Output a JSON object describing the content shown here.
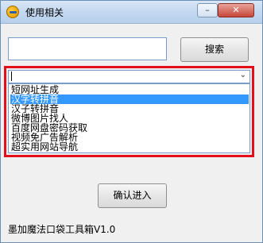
{
  "window": {
    "title": "使用相关",
    "minimize_label": "–",
    "close_label": "✕"
  },
  "search": {
    "value": "",
    "button_label": "搜索"
  },
  "combo": {
    "value": "",
    "arrow": "⌄"
  },
  "list": {
    "items": [
      {
        "label": "短网址生成"
      },
      {
        "label": "汉字转拼音"
      },
      {
        "label": "汉子转拼音"
      },
      {
        "label": "微博图片找人"
      },
      {
        "label": "百度网盘密码获取"
      },
      {
        "label": "视频免广告解析"
      },
      {
        "label": "超实用网站导航"
      }
    ],
    "selected_index": 1
  },
  "confirm": {
    "label": "确认进入"
  },
  "footer": {
    "text": "墨加魔法口袋工具箱V1.0"
  },
  "colors": {
    "highlight_frame": "#e3101b",
    "selection": "#3399ff"
  }
}
